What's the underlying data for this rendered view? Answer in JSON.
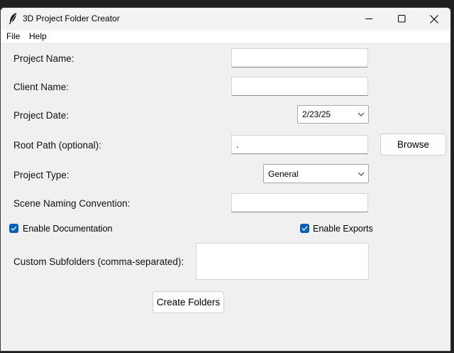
{
  "window": {
    "title": "3D Project Folder Creator",
    "icon": "feather-icon",
    "controls": [
      "minimize-icon",
      "maximize-icon",
      "close-icon"
    ]
  },
  "menu": {
    "items": [
      "File",
      "Help"
    ]
  },
  "form": {
    "project_name": {
      "label": "Project Name:",
      "value": ""
    },
    "client_name": {
      "label": "Client Name:",
      "value": ""
    },
    "project_date": {
      "label": "Project Date:",
      "value": "2/23/25"
    },
    "root_path": {
      "label": "Root Path (optional):",
      "value": ".",
      "browse_label": "Browse"
    },
    "project_type": {
      "label": "Project Type:",
      "value": "General"
    },
    "scene_naming": {
      "label": "Scene Naming Convention:",
      "value": ""
    },
    "enable_documentation": {
      "label": "Enable Documentation",
      "checked": true
    },
    "enable_exports": {
      "label": "Enable Exports",
      "checked": true
    },
    "custom_subfolders": {
      "label": "Custom Subfolders (comma-separated):",
      "value": ""
    },
    "create_label": "Create Folders"
  },
  "colors": {
    "accent": "#005fb8",
    "window_bg": "#f0f0f0"
  }
}
